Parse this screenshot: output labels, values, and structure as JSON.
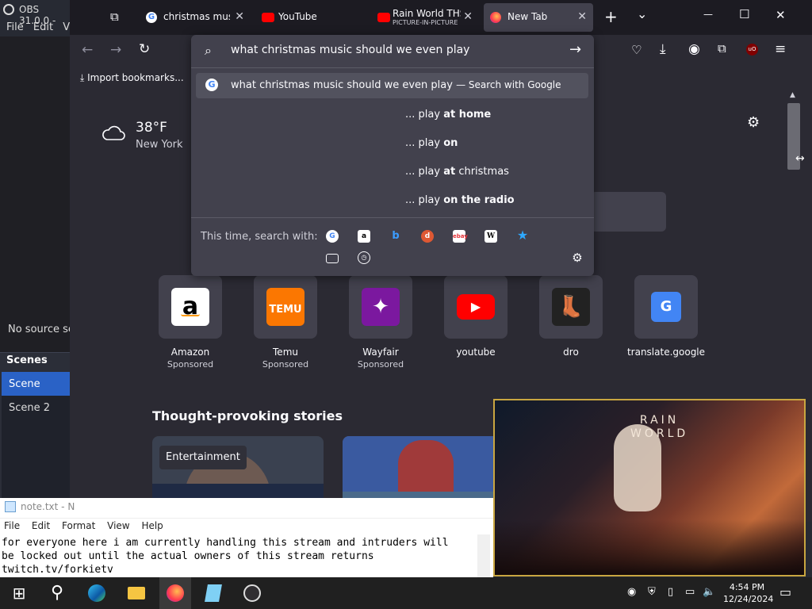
{
  "obs": {
    "title": "OBS 31.0.0 -",
    "menu": [
      "File",
      "Edit",
      "V"
    ],
    "no_source": "No source se",
    "scenes_title": "Scenes",
    "scenes": [
      "Scene",
      "Scene 2"
    ]
  },
  "tabs": [
    {
      "title": "christmas music",
      "sub": ""
    },
    {
      "title": "YouTube",
      "sub": ""
    },
    {
      "title": "Rain World THS",
      "sub": "PICTURE-IN-PICTURE"
    },
    {
      "title": "New Tab",
      "sub": ""
    }
  ],
  "window_controls": {
    "new_tab": "+",
    "list": "⌄",
    "minimize": "—",
    "maximize": "☐",
    "close": "✕"
  },
  "bookmarks": {
    "import": "Import bookmarks..."
  },
  "urlbar": {
    "value": "what christmas music should we even play",
    "main_suggestion": "what christmas music should we even play",
    "main_suggestion_suffix": "— Search with Google",
    "suggestions": [
      {
        "prefix": "... play ",
        "bold": "at home",
        "rest": ""
      },
      {
        "prefix": "... play ",
        "bold": "on",
        "rest": ""
      },
      {
        "prefix": "... play ",
        "bold": "at",
        "rest": " christmas"
      },
      {
        "prefix": "... play ",
        "bold": "on the radio",
        "rest": ""
      }
    ],
    "oneoff_label": "This time, search with:",
    "engines": [
      "Google",
      "Amazon",
      "Bing",
      "DuckDuckGo",
      "eBay",
      "Wikipedia",
      "Bookmark-star"
    ]
  },
  "weather": {
    "temp": "38°F",
    "city": "New York"
  },
  "shortcuts": [
    {
      "name": "Amazon",
      "sponsored": "Sponsored",
      "logo": "a",
      "color": "#ffffff",
      "fg": "#000000"
    },
    {
      "name": "Temu",
      "sponsored": "Sponsored",
      "logo": "TEMU",
      "color": "#fb7701",
      "fg": "#ffffff"
    },
    {
      "name": "Wayfair",
      "sponsored": "Sponsored",
      "logo": "✦",
      "color": "#7b189f",
      "fg": "#ffffff"
    },
    {
      "name": "youtube",
      "sponsored": "",
      "logo": "▶",
      "color": "#ff0000",
      "fg": "#ffffff"
    },
    {
      "name": "dro",
      "sponsored": "",
      "logo": "👢",
      "color": "#222222",
      "fg": "#e8a020"
    },
    {
      "name": "translate.google",
      "sponsored": "",
      "logo": "G",
      "color": "#4285f4",
      "fg": "#ffffff"
    }
  ],
  "stories": {
    "title": "Thought-provoking stories",
    "tag": "Entertainment"
  },
  "pip": {
    "title_line1": "RAIN",
    "title_line2": "WORLD"
  },
  "notepad": {
    "title": "note.txt - N",
    "menu": [
      "File",
      "Edit",
      "Format",
      "View",
      "Help"
    ],
    "lines": [
      "for everyone here i am currently handling this stream and intruders will",
      "be locked out until the actual owners of this stream returns",
      "twitch.tv/forkietv"
    ]
  },
  "taskbar": {
    "time": "4:54 PM",
    "date": "12/24/2024"
  },
  "colors": {
    "accent": "#2a62c6",
    "firefox_bg": "#2b2a33",
    "popup_bg": "#42414d",
    "pip_border": "#c9a640"
  }
}
